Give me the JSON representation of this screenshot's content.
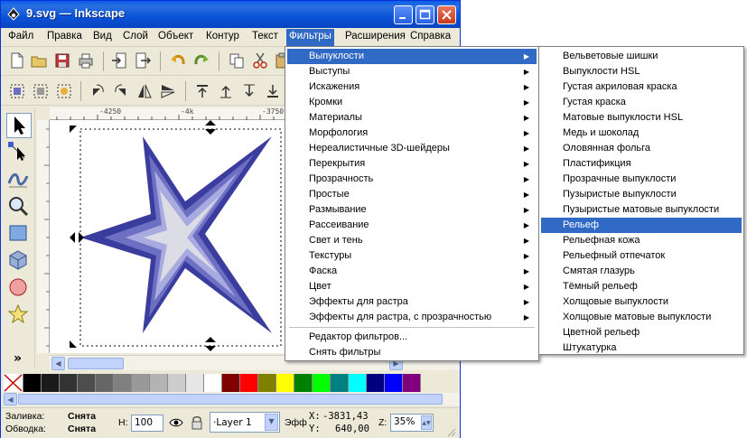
{
  "window": {
    "title": "9.svg — Inkscape"
  },
  "menubar": [
    "Файл",
    "Правка",
    "Вид",
    "Слой",
    "Объект",
    "Контур",
    "Текст",
    "Фильтры",
    "Расширения",
    "Справка"
  ],
  "ruler": {
    "top_labels": [
      "-4250",
      "-4k",
      "-3750"
    ]
  },
  "filters_menu": {
    "items": [
      "Выпуклости",
      "Выступы",
      "Искажения",
      "Кромки",
      "Материалы",
      "Морфология",
      "Нереалистичные 3D-шейдеры",
      "Перекрытия",
      "Прозрачность",
      "Простые",
      "Размывание",
      "Рассеивание",
      "Свет и тень",
      "Текстуры",
      "Фаска",
      "Цвет",
      "Эффекты для растра",
      "Эффекты для растра, с прозрачностью"
    ],
    "extra": [
      "Редактор фильтров...",
      "Снять фильтры"
    ]
  },
  "bumps_submenu": {
    "items": [
      "Вельветовые шишки",
      "Выпуклости HSL",
      "Густая акриловая краска",
      "Густая краска",
      "Матовые выпуклости HSL",
      "Медь и шоколад",
      "Оловянная фольга",
      "Пластификция",
      "Прозрачные выпуклости",
      "Пузыристые выпуклости",
      "Пузыристые матовые выпуклости",
      "Рельеф",
      "Рельефная кожа",
      "Рельефный отпечаток",
      "Смятая глазурь",
      "Тёмный рельеф",
      "Холщовые выпуклости",
      "Холщовые матовые выпуклости",
      "Цветной рельеф",
      "Штукатурка"
    ],
    "highlighted": "Рельеф"
  },
  "statusbar": {
    "fill_label": "Заливка:",
    "fill_value": "Снята",
    "stroke_label": "Обводка:",
    "stroke_value": "Снята",
    "h_label": "H:",
    "h_value": "100",
    "layer": "·Layer 1",
    "effect_label": "Эфф",
    "x_label": "X:",
    "x_value": "-3831,43",
    "y_label": "Y:",
    "y_value": "640,00",
    "z_label": "Z:",
    "zoom": "35%"
  },
  "colors": {
    "title_blue": "#0a52d6",
    "menu_highlight": "#316ac5",
    "star_dark": "#3a3d9e",
    "star_mid": "#6d6fc2",
    "star_light": "#a9abe0",
    "star_center": "#dcdce6"
  },
  "palette": [
    "#000000",
    "#1a1a1a",
    "#333333",
    "#4d4d4d",
    "#666666",
    "#808080",
    "#999999",
    "#b3b3b3",
    "#cccccc",
    "#e6e6e6",
    "#ffffff",
    "#800000",
    "#ff0000",
    "#808000",
    "#ffff00",
    "#008000",
    "#00ff00",
    "#008080",
    "#00ffff",
    "#000080",
    "#0000ff",
    "#800080"
  ]
}
